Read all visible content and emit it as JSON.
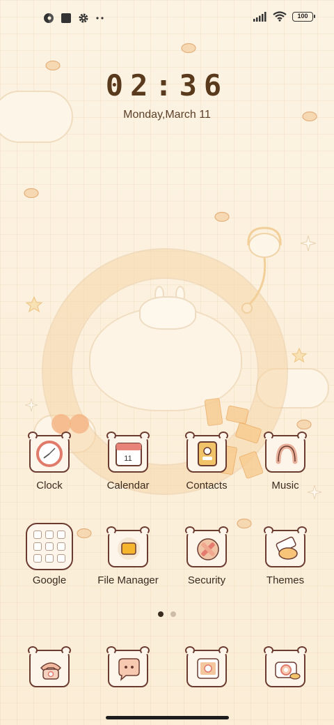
{
  "status_bar": {
    "battery_level": "100",
    "icons": [
      "vpn-icon",
      "square-icon",
      "settings-gear-icon",
      "more-dots-icon",
      "signal-icon",
      "wifi-icon",
      "battery-icon"
    ]
  },
  "lock": {
    "time": "02:36",
    "date": "Monday,March 11"
  },
  "apps": {
    "row1": [
      {
        "label": "Clock",
        "icon": "clock-icon"
      },
      {
        "label": "Calendar",
        "icon": "calendar-icon",
        "badge": "11"
      },
      {
        "label": "Contacts",
        "icon": "contacts-icon"
      },
      {
        "label": "Music",
        "icon": "music-icon"
      }
    ],
    "row2": [
      {
        "label": "Google",
        "icon": "google-folder-icon"
      },
      {
        "label": "File Manager",
        "icon": "folder-icon"
      },
      {
        "label": "Security",
        "icon": "security-icon"
      },
      {
        "label": "Themes",
        "icon": "themes-icon"
      }
    ],
    "dock": [
      {
        "icon": "phone-icon"
      },
      {
        "icon": "messages-icon"
      },
      {
        "icon": "gallery-icon"
      },
      {
        "icon": "camera-icon"
      }
    ]
  },
  "pager": {
    "pages": 2,
    "current": 1
  },
  "colors": {
    "background": "#fbf0dc",
    "icon_border": "#6b3b30",
    "text": "#3b2a1e",
    "time": "#5a3a1c"
  }
}
